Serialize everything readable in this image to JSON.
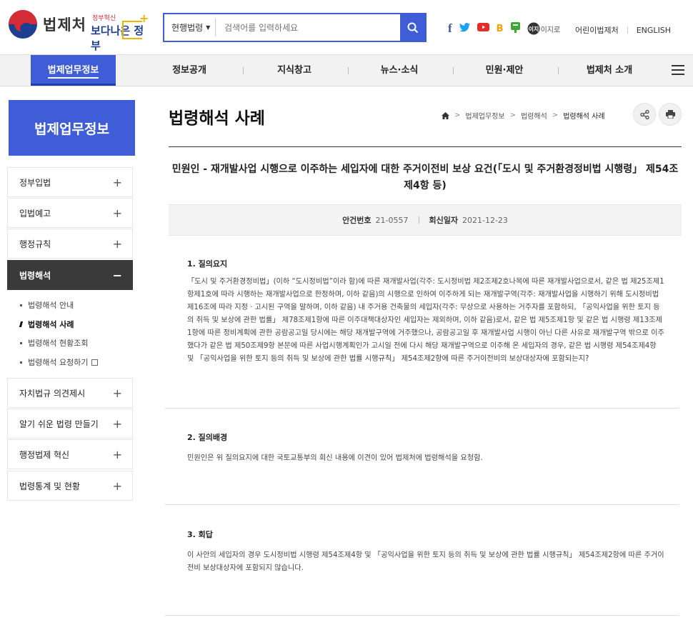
{
  "header": {
    "logo_text": "법제처",
    "slogan_small": "정부혁신",
    "slogan_big": "보다나은 정부",
    "search": {
      "scope": "현행법령",
      "placeholder": "검색어를 입력하세요"
    },
    "sns": [
      {
        "name": "facebook-icon",
        "glyph": "f",
        "color": "#3b5998"
      },
      {
        "name": "twitter-icon",
        "glyph": "t",
        "color": "#1da1f2"
      },
      {
        "name": "youtube-icon",
        "glyph": "▶",
        "color": "#e52d27"
      },
      {
        "name": "blog-icon",
        "glyph": "B",
        "color": "#f2a100"
      },
      {
        "name": "post-icon",
        "glyph": "P",
        "color": "#3fa535"
      }
    ],
    "easylaw_label": "이지로",
    "util": [
      "어린이법제처",
      "ENGLISH"
    ]
  },
  "gnb": [
    "법제업무정보",
    "정보공개",
    "지식창고",
    "뉴스·소식",
    "민원·제안",
    "법제처 소개"
  ],
  "lnb": {
    "title": "법제업무정보",
    "items": [
      "정부입법",
      "입법예고",
      "행정규칙",
      "법령해석"
    ],
    "subs": [
      "법령해석 안내",
      "법령해석 사례",
      "법령해석 현황조회",
      "법령해석 요청하기"
    ],
    "items2": [
      "자치법규 의견제시",
      "알기 쉬운 법령 만들기",
      "행정법제 혁신",
      "법령통계 및 현황"
    ]
  },
  "content": {
    "page_title": "법령해석 사례",
    "breadcrumb": [
      "법제업무정보",
      "법령해석",
      "법령해석 사례"
    ],
    "doc_title": "민원인 - 재개발사업 시행으로 이주하는 세입자에 대한 주거이전비 보상 요건(「도시 및 주거환경정비법 시행령」 제54조제4항 등)",
    "meta": {
      "case_label": "안건번호",
      "case_no": "21-0557",
      "reply_label": "회신일자",
      "reply_date": "2021-12-23"
    },
    "sections": [
      {
        "heading": "1. 질의요지",
        "body": "「도시 및 주거환경정비법」(이하 “도시정비법”이라 함)에 따른 재개발사업(각주: 도시정비법 제2조제2호나목에 따른 재개발사업으로서, 같은 법 제25조제1항제1호에 따라 시행하는 재개발사업으로 한정하며, 이하 같음)의 시행으로 인하여 이주하게 되는 재개발구역(각주: 재개발사업을 시행하기 위해 도시정비법 제16조에 따라 지정ㆍ고시된 구역을 말하며, 이하 같음) 내 주거용 건축물의 세입자(각주: 무상으로 사용하는 거주자를 포함하되, 「공익사업을 위한 토지 등의 취득 및 보상에 관한 법률」 제78조제1항에 따른 이주대책대상자인 세입자는 제외하며, 이하 같음)로서, 같은 법 제5조제1항 및 같은 법 시행령 제13조제1항에 따른 정비계획에 관한 공람공고일 당시에는 해당 재개발구역에 거주했으나, 공람공고일 후 재개발사업 시행이 아닌 다른 사유로 재개발구역 밖으로 이주했다가 같은 법 제50조제9항 본문에 따른 사업시행계획인가 고시일 전에 다시 해당 재개발구역으로 이주해 온 세입자의 경우, 같은 법 시행령 제54조제4항 및 「공익사업을 위한 토지 등의 취득 및 보상에 관한 법률 시행규칙」 제54조제2항에 따른 주거이전비의 보상대상자에 포함되는지?"
      },
      {
        "heading": "2. 질의배경",
        "body": "민원인은 위 질의요지에 대한 국토교통부의 회신 내용에 이견이 있어 법제처에 법령해석을 요청함."
      },
      {
        "heading": "3. 회답",
        "body": "이 사안의 세입자의 경우 도시정비법 시행령 제54조제4항 및 「공익사업을 위한 토지 등의 취득 및 보상에 관한 법률 시행규칙」 제54조제2항에 따른 주거이전비 보상대상자에 포함되지 않습니다."
      }
    ]
  }
}
